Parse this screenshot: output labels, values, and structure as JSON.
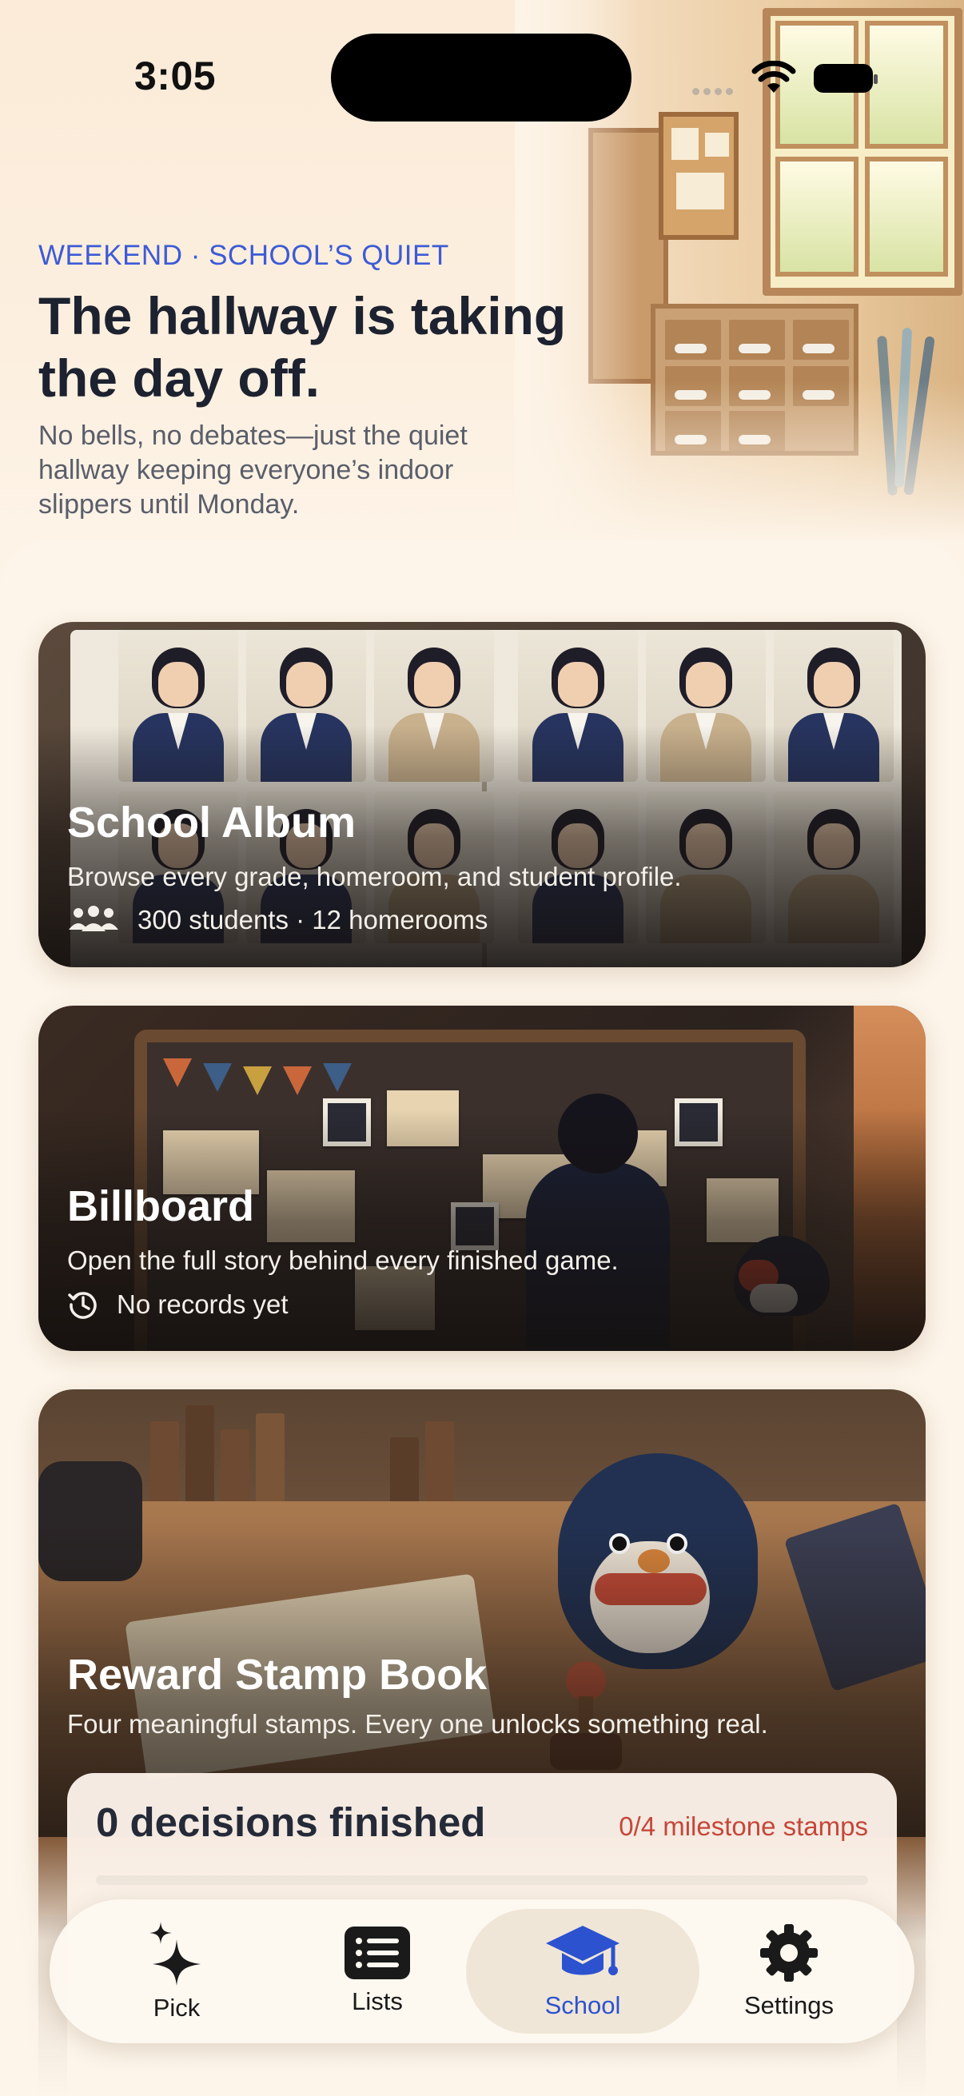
{
  "status_bar": {
    "time": "3:05"
  },
  "hero": {
    "kicker": "WEEKEND · SCHOOL’S QUIET",
    "headline": "The hallway is taking the day off.",
    "subtitle": "No bells, no debates—just the quiet hallway keeping everyone’s indoor slippers until Monday."
  },
  "cards": {
    "album": {
      "title": "School Album",
      "description": "Browse every grade, homeroom, and student profile.",
      "meta": "300 students · 12 homerooms",
      "icon": "people-icon"
    },
    "billboard": {
      "title": "Billboard",
      "description": "Open the full story behind every finished game.",
      "meta": "No records yet",
      "icon": "history-icon"
    },
    "stamp_book": {
      "title": "Reward Stamp Book",
      "description": "Four meaningful stamps. Every one unlocks something real.",
      "decisions": "0 decisions finished",
      "milestones": "0/4 milestone stamps",
      "progress": 0
    }
  },
  "tabbar": {
    "active": "School",
    "tabs": [
      {
        "label": "Pick",
        "icon": "sparkles-icon"
      },
      {
        "label": "Lists",
        "icon": "list-icon"
      },
      {
        "label": "School",
        "icon": "graduation-cap-icon"
      },
      {
        "label": "Settings",
        "icon": "gear-icon"
      }
    ]
  },
  "colors": {
    "accent": "#3d5bd6",
    "active_tab": "#2d52cf",
    "milestone": "#c5473a",
    "background": "#fdf4e8"
  }
}
